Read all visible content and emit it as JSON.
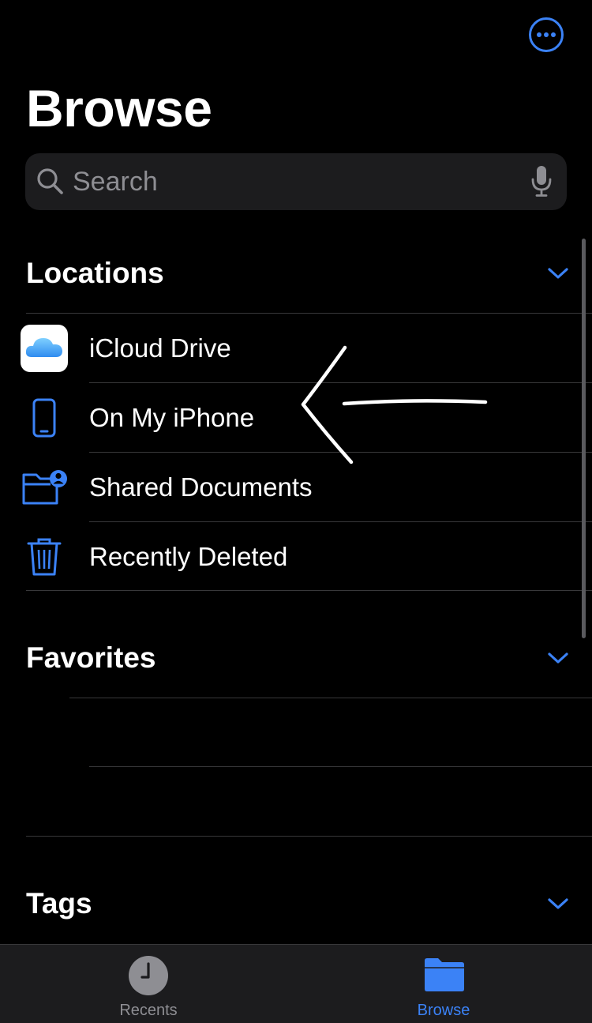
{
  "header": {
    "title": "Browse",
    "more_icon": "ellipsis-circle-icon"
  },
  "search": {
    "placeholder": "Search",
    "value": "",
    "mic_icon": "microphone-icon"
  },
  "sections": {
    "locations": {
      "title": "Locations",
      "expanded": true,
      "items": [
        {
          "label": "iCloud Drive",
          "icon": "icloud-drive-icon"
        },
        {
          "label": "On My iPhone",
          "icon": "iphone-icon"
        },
        {
          "label": "Shared Documents",
          "icon": "shared-folder-icon"
        },
        {
          "label": "Recently Deleted",
          "icon": "trash-icon"
        }
      ]
    },
    "favorites": {
      "title": "Favorites",
      "expanded": true
    },
    "tags": {
      "title": "Tags",
      "expanded": true
    }
  },
  "annotation": {
    "type": "hand-drawn-arrow",
    "points_to": "On My iPhone",
    "color": "#ffffff"
  },
  "tab_bar": {
    "tabs": [
      {
        "label": "Recents",
        "icon": "clock-icon",
        "selected": false
      },
      {
        "label": "Browse",
        "icon": "folder-icon",
        "selected": true
      }
    ]
  },
  "colors": {
    "accent": "#3b82f6",
    "background": "#000000",
    "secondary_text": "#8e8e93",
    "separator": "#38383a"
  }
}
